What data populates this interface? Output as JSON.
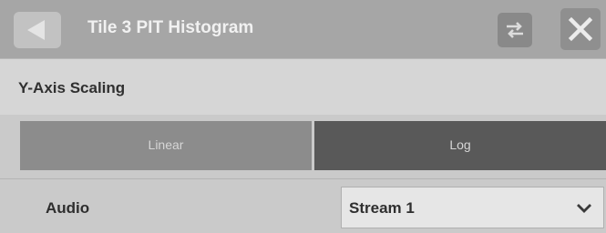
{
  "header": {
    "title": "Tile 3 PIT Histogram",
    "back_icon": "back-arrow-icon",
    "swap_icon": "swap-icon",
    "close_icon": "close-icon"
  },
  "y_axis_scaling": {
    "label": "Y-Axis Scaling",
    "options": [
      "Linear",
      "Log"
    ],
    "selected": "Log"
  },
  "audio": {
    "label": "Audio",
    "selected_value": "Stream 1",
    "dropdown_icon": "chevron-down-icon"
  },
  "colors": {
    "titlebar": "#a6a6a6",
    "selected_segment": "#595959",
    "unselected_segment": "#8c8c8c"
  }
}
